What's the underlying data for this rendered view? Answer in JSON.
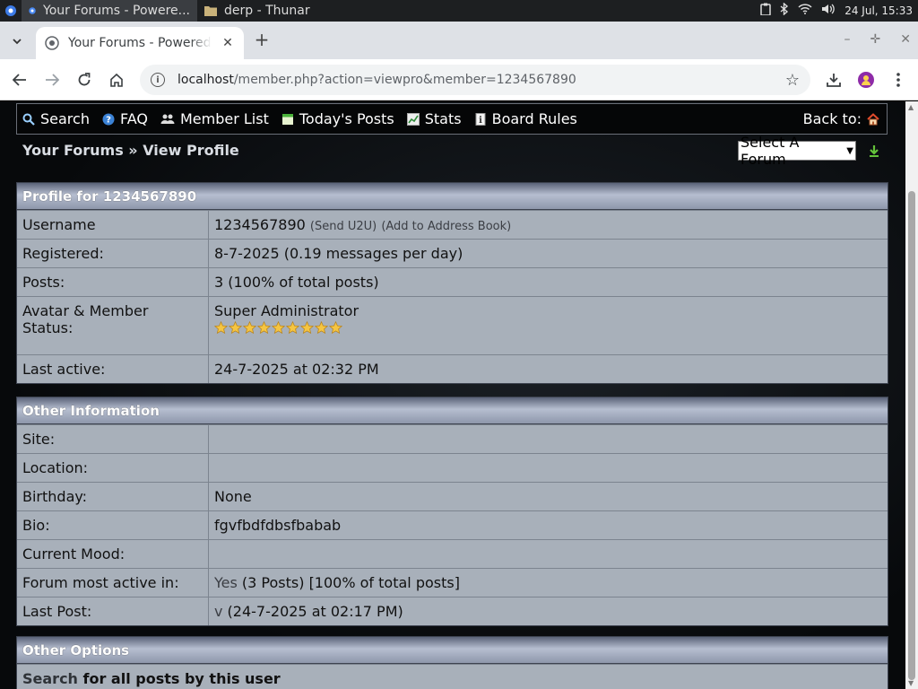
{
  "taskbar": {
    "tasks": [
      {
        "label": "Your Forums - Powere..."
      },
      {
        "label": "derp - Thunar"
      }
    ],
    "clock": "24 Jul, 15:33"
  },
  "browser": {
    "tab_title": "Your Forums - Powered",
    "url_host": "localhost",
    "url_path": "/member.php?action=viewpro&member=1234567890"
  },
  "forum_nav": {
    "items": [
      {
        "label": "Search",
        "icon": "magnifier-icon"
      },
      {
        "label": "FAQ",
        "icon": "help-icon"
      },
      {
        "label": "Member List",
        "icon": "members-icon"
      },
      {
        "label": "Today's Posts",
        "icon": "todays-posts-icon"
      },
      {
        "label": "Stats",
        "icon": "stats-icon"
      },
      {
        "label": "Board Rules",
        "icon": "rules-icon"
      }
    ],
    "back_to": "Back to:"
  },
  "breadcrumb": "Your Forums » View Profile",
  "forum_select": {
    "value": "Select A Forum"
  },
  "profile": {
    "title": "Profile for 1234567890",
    "username_label": "Username",
    "username": "1234567890",
    "send_u2u": "(Send U2U)",
    "add_address": "(Add to Address Book)",
    "registered_label": "Registered:",
    "registered": "8-7-2025 (0.19 messages per day)",
    "posts_label": "Posts:",
    "posts": "3 (100% of total posts)",
    "avatar_label": "Avatar & Member Status:",
    "status": "Super Administrator",
    "star_count": 9,
    "last_active_label": "Last active:",
    "last_active": "24-7-2025 at 02:32 PM"
  },
  "other_info": {
    "title": "Other Information",
    "site_label": "Site:",
    "site": "",
    "location_label": "Location:",
    "location": "",
    "birthday_label": "Birthday:",
    "birthday": "None",
    "bio_label": "Bio:",
    "bio": "fgvfbdfdbsfbabab",
    "mood_label": "Current Mood:",
    "mood": "",
    "most_active_label": "Forum most active in:",
    "most_active_link": "Yes",
    "most_active_rest": " (3 Posts) [100% of total posts]",
    "last_post_label": "Last Post:",
    "last_post_link": "v",
    "last_post_rest": " (24-7-2025 at 02:17 PM)"
  },
  "other_options": {
    "title": "Other Options",
    "search_link": "Search",
    "search_rest": " for all posts by this user"
  },
  "colors": {
    "header_gradient_mid": "#b6bed0",
    "cell_bg": "#a8b0ba",
    "page_bg": "#07090b"
  }
}
